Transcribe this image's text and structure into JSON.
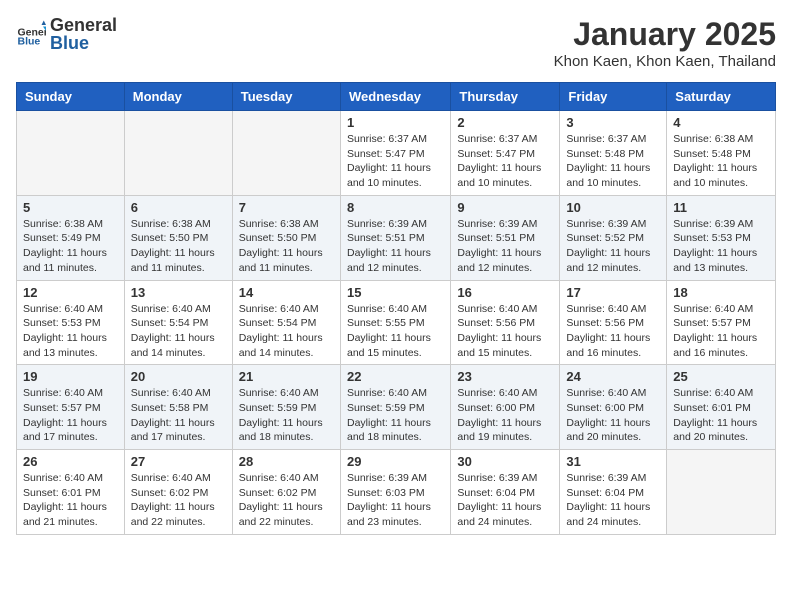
{
  "header": {
    "logo_general": "General",
    "logo_blue": "Blue",
    "month": "January 2025",
    "location": "Khon Kaen, Khon Kaen, Thailand"
  },
  "days_of_week": [
    "Sunday",
    "Monday",
    "Tuesday",
    "Wednesday",
    "Thursday",
    "Friday",
    "Saturday"
  ],
  "weeks": [
    [
      {
        "day": "",
        "info": ""
      },
      {
        "day": "",
        "info": ""
      },
      {
        "day": "",
        "info": ""
      },
      {
        "day": "1",
        "info": "Sunrise: 6:37 AM\nSunset: 5:47 PM\nDaylight: 11 hours and 10 minutes."
      },
      {
        "day": "2",
        "info": "Sunrise: 6:37 AM\nSunset: 5:47 PM\nDaylight: 11 hours and 10 minutes."
      },
      {
        "day": "3",
        "info": "Sunrise: 6:37 AM\nSunset: 5:48 PM\nDaylight: 11 hours and 10 minutes."
      },
      {
        "day": "4",
        "info": "Sunrise: 6:38 AM\nSunset: 5:48 PM\nDaylight: 11 hours and 10 minutes."
      }
    ],
    [
      {
        "day": "5",
        "info": "Sunrise: 6:38 AM\nSunset: 5:49 PM\nDaylight: 11 hours and 11 minutes."
      },
      {
        "day": "6",
        "info": "Sunrise: 6:38 AM\nSunset: 5:50 PM\nDaylight: 11 hours and 11 minutes."
      },
      {
        "day": "7",
        "info": "Sunrise: 6:38 AM\nSunset: 5:50 PM\nDaylight: 11 hours and 11 minutes."
      },
      {
        "day": "8",
        "info": "Sunrise: 6:39 AM\nSunset: 5:51 PM\nDaylight: 11 hours and 12 minutes."
      },
      {
        "day": "9",
        "info": "Sunrise: 6:39 AM\nSunset: 5:51 PM\nDaylight: 11 hours and 12 minutes."
      },
      {
        "day": "10",
        "info": "Sunrise: 6:39 AM\nSunset: 5:52 PM\nDaylight: 11 hours and 12 minutes."
      },
      {
        "day": "11",
        "info": "Sunrise: 6:39 AM\nSunset: 5:53 PM\nDaylight: 11 hours and 13 minutes."
      }
    ],
    [
      {
        "day": "12",
        "info": "Sunrise: 6:40 AM\nSunset: 5:53 PM\nDaylight: 11 hours and 13 minutes."
      },
      {
        "day": "13",
        "info": "Sunrise: 6:40 AM\nSunset: 5:54 PM\nDaylight: 11 hours and 14 minutes."
      },
      {
        "day": "14",
        "info": "Sunrise: 6:40 AM\nSunset: 5:54 PM\nDaylight: 11 hours and 14 minutes."
      },
      {
        "day": "15",
        "info": "Sunrise: 6:40 AM\nSunset: 5:55 PM\nDaylight: 11 hours and 15 minutes."
      },
      {
        "day": "16",
        "info": "Sunrise: 6:40 AM\nSunset: 5:56 PM\nDaylight: 11 hours and 15 minutes."
      },
      {
        "day": "17",
        "info": "Sunrise: 6:40 AM\nSunset: 5:56 PM\nDaylight: 11 hours and 16 minutes."
      },
      {
        "day": "18",
        "info": "Sunrise: 6:40 AM\nSunset: 5:57 PM\nDaylight: 11 hours and 16 minutes."
      }
    ],
    [
      {
        "day": "19",
        "info": "Sunrise: 6:40 AM\nSunset: 5:57 PM\nDaylight: 11 hours and 17 minutes."
      },
      {
        "day": "20",
        "info": "Sunrise: 6:40 AM\nSunset: 5:58 PM\nDaylight: 11 hours and 17 minutes."
      },
      {
        "day": "21",
        "info": "Sunrise: 6:40 AM\nSunset: 5:59 PM\nDaylight: 11 hours and 18 minutes."
      },
      {
        "day": "22",
        "info": "Sunrise: 6:40 AM\nSunset: 5:59 PM\nDaylight: 11 hours and 18 minutes."
      },
      {
        "day": "23",
        "info": "Sunrise: 6:40 AM\nSunset: 6:00 PM\nDaylight: 11 hours and 19 minutes."
      },
      {
        "day": "24",
        "info": "Sunrise: 6:40 AM\nSunset: 6:00 PM\nDaylight: 11 hours and 20 minutes."
      },
      {
        "day": "25",
        "info": "Sunrise: 6:40 AM\nSunset: 6:01 PM\nDaylight: 11 hours and 20 minutes."
      }
    ],
    [
      {
        "day": "26",
        "info": "Sunrise: 6:40 AM\nSunset: 6:01 PM\nDaylight: 11 hours and 21 minutes."
      },
      {
        "day": "27",
        "info": "Sunrise: 6:40 AM\nSunset: 6:02 PM\nDaylight: 11 hours and 22 minutes."
      },
      {
        "day": "28",
        "info": "Sunrise: 6:40 AM\nSunset: 6:02 PM\nDaylight: 11 hours and 22 minutes."
      },
      {
        "day": "29",
        "info": "Sunrise: 6:39 AM\nSunset: 6:03 PM\nDaylight: 11 hours and 23 minutes."
      },
      {
        "day": "30",
        "info": "Sunrise: 6:39 AM\nSunset: 6:04 PM\nDaylight: 11 hours and 24 minutes."
      },
      {
        "day": "31",
        "info": "Sunrise: 6:39 AM\nSunset: 6:04 PM\nDaylight: 11 hours and 24 minutes."
      },
      {
        "day": "",
        "info": ""
      }
    ]
  ]
}
